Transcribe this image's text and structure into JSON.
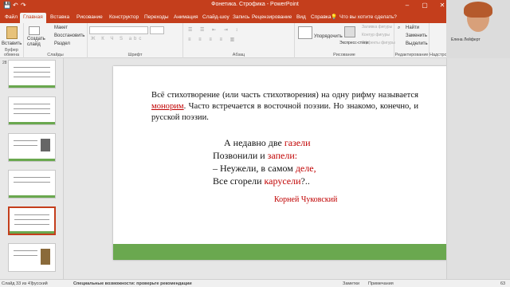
{
  "window": {
    "title": "Фонетика. Строфика - PowerPoint"
  },
  "tabs": [
    "Файл",
    "Главная",
    "Вставка",
    "Рисование",
    "Конструктор",
    "Переходы",
    "Анимация",
    "Слайд-шоу",
    "Запись",
    "Рецензирование",
    "Вид",
    "Справка"
  ],
  "tell_me": "Что вы хотите сделать?",
  "ribbon": {
    "paste_label": "Вставить",
    "create_slide": "Создать слайд",
    "reuse_slides": "Повторно использовать слайд",
    "layout": "Макет",
    "reset": "Восстановить",
    "section": "Раздел",
    "arrange": "Упорядочить",
    "quick_styles": "Экспресс-стили",
    "shape_fill": "Заливка фигуры",
    "shape_outline": "Контур фигуры",
    "shape_effects": "Эффекты фигуры",
    "find": "Найти",
    "replace": "Заменить",
    "select": "Выделить",
    "groups": {
      "clipboard": "Буфер обмена",
      "slides": "Слайды",
      "font": "Шрифт",
      "paragraph": "Абзац",
      "drawing": "Рисование",
      "editing": "Редактирование",
      "addins": "Надстройки"
    }
  },
  "webcam": {
    "name": "Елена Лейферт"
  },
  "slide": {
    "paragraph_before": "Всё стихотворение (или часть стихотворения) на одну рифму называется ",
    "paragraph_term": "монорим",
    "paragraph_after": ". Часто встречается в восточной поэзии. Но знакомо, конечно, и русской поэзии.",
    "poem": [
      {
        "text": "А недавно две ",
        "rhyme": "газели"
      },
      {
        "text": "Позвонили и ",
        "rhyme": "запели:"
      },
      {
        "text": "– Неужели, в самом ",
        "rhyme": "деле,"
      },
      {
        "text": "Все сгорели ",
        "rhyme": "карусели",
        "tail": "?.."
      }
    ],
    "author": "Корней Чуковский"
  },
  "status": {
    "slide_info": "Слайд 33 из 47",
    "language": "русский",
    "accessibility": "Специальные возможности: проверьте рекомендации",
    "notes": "Заметки",
    "comments": "Примечания",
    "zoom": "63"
  }
}
